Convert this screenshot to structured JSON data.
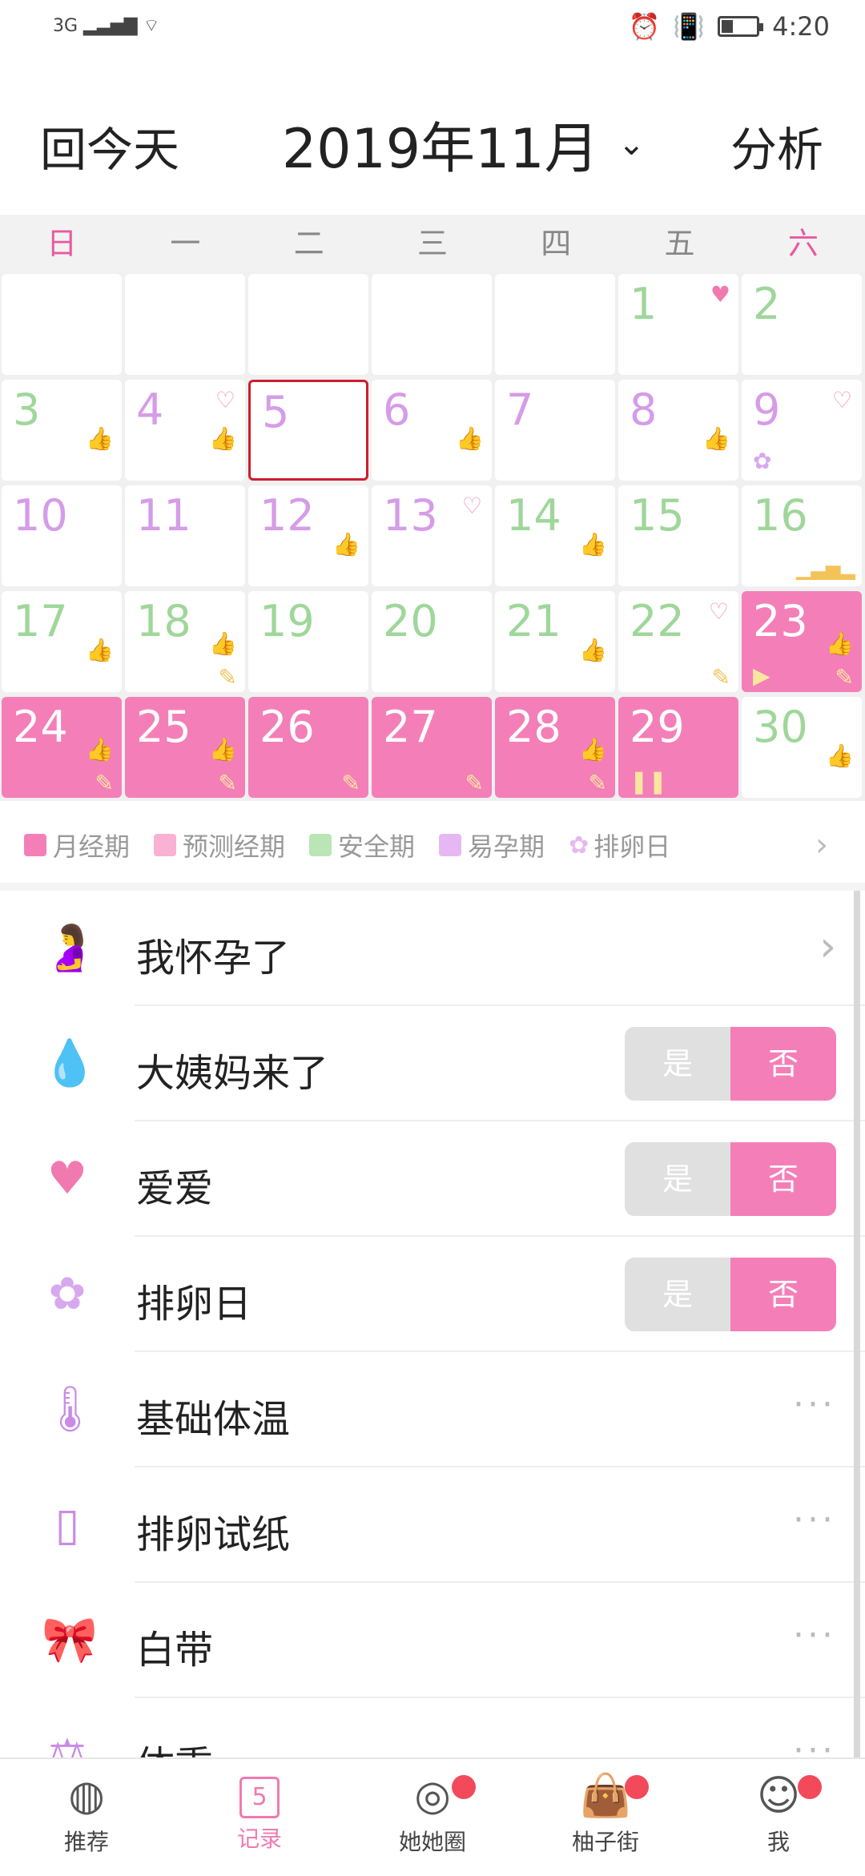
{
  "statusbar": {
    "network": "3G",
    "time": "4:20"
  },
  "header": {
    "today": "回今天",
    "month": "2019年11月",
    "analyze": "分析"
  },
  "weekdays": [
    "日",
    "一",
    "二",
    "三",
    "四",
    "五",
    "六"
  ],
  "calendar": {
    "days": [
      {
        "num": "1"
      },
      {
        "num": "2"
      },
      {
        "num": "3"
      },
      {
        "num": "4"
      },
      {
        "num": "5"
      },
      {
        "num": "6"
      },
      {
        "num": "7"
      },
      {
        "num": "8"
      },
      {
        "num": "9"
      },
      {
        "num": "10"
      },
      {
        "num": "11"
      },
      {
        "num": "12"
      },
      {
        "num": "13"
      },
      {
        "num": "14"
      },
      {
        "num": "15"
      },
      {
        "num": "16"
      },
      {
        "num": "17"
      },
      {
        "num": "18"
      },
      {
        "num": "19"
      },
      {
        "num": "20"
      },
      {
        "num": "21"
      },
      {
        "num": "22"
      },
      {
        "num": "23"
      },
      {
        "num": "24"
      },
      {
        "num": "25"
      },
      {
        "num": "26"
      },
      {
        "num": "27"
      },
      {
        "num": "28"
      },
      {
        "num": "29"
      },
      {
        "num": "30"
      }
    ]
  },
  "legend": {
    "items": [
      "月经期",
      "预测经期",
      "安全期",
      "易孕期",
      "排卵日"
    ],
    "colors": [
      "#f47fb8",
      "#f9b2d3",
      "#b9e6b4",
      "#e6b8f3",
      "#f3e2fb"
    ]
  },
  "records": {
    "rows": [
      {
        "label": "我怀孕了",
        "icon": "pregnant-icon"
      },
      {
        "label": "大姨妈来了",
        "icon": "drop-icon"
      },
      {
        "label": "爱爱",
        "icon": "heart-lock-icon"
      },
      {
        "label": "排卵日",
        "icon": "flower-icon"
      },
      {
        "label": "基础体温",
        "icon": "thermometer-icon"
      },
      {
        "label": "排卵试纸",
        "icon": "test-strip-icon"
      },
      {
        "label": "白带",
        "icon": "ribbon-icon"
      },
      {
        "label": "体重",
        "icon": "scale-icon"
      }
    ],
    "toggle": {
      "yes": "是",
      "no": "否"
    }
  },
  "tabbar": {
    "items": [
      "推荐",
      "记录",
      "她她圈",
      "柚子街",
      "我"
    ],
    "record_day": "5"
  }
}
